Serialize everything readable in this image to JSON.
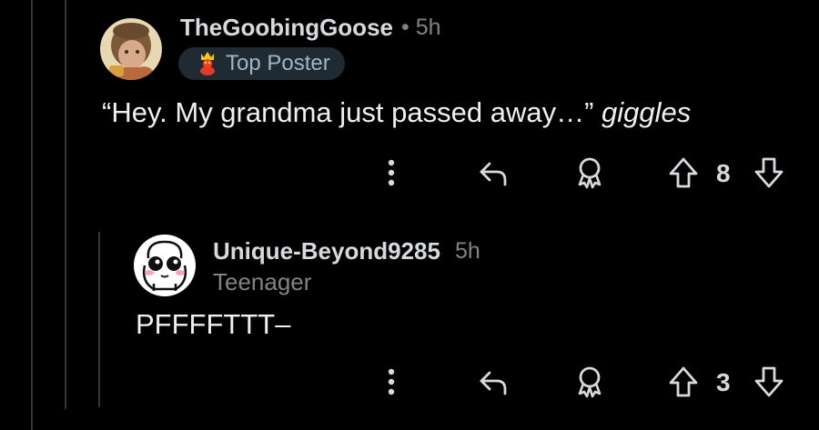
{
  "comments": [
    {
      "username": "TheGoobingGoose",
      "separator": "•",
      "time": "5h",
      "flair": "Top Poster",
      "body_quote": "“Hey. My grandma just passed away…”",
      "body_italic": "giggles",
      "score": "8"
    },
    {
      "username": "Unique-Beyond9285",
      "time": "5h",
      "flair": "Teenager",
      "body": "PFFFFTTT–",
      "score": "3"
    }
  ],
  "icons": {
    "more": "more-vertical-icon",
    "reply": "reply-arrow-icon",
    "award": "award-icon",
    "upvote": "upvote-arrow-icon",
    "downvote": "downvote-arrow-icon",
    "flair": "crown-mascot-icon"
  },
  "colors": {
    "background": "#000000",
    "text": "#d7dadc",
    "muted": "#818384",
    "flair_bg": "#1f2a33",
    "flair_text": "#9fb6c7",
    "thread_line": "#343536"
  }
}
